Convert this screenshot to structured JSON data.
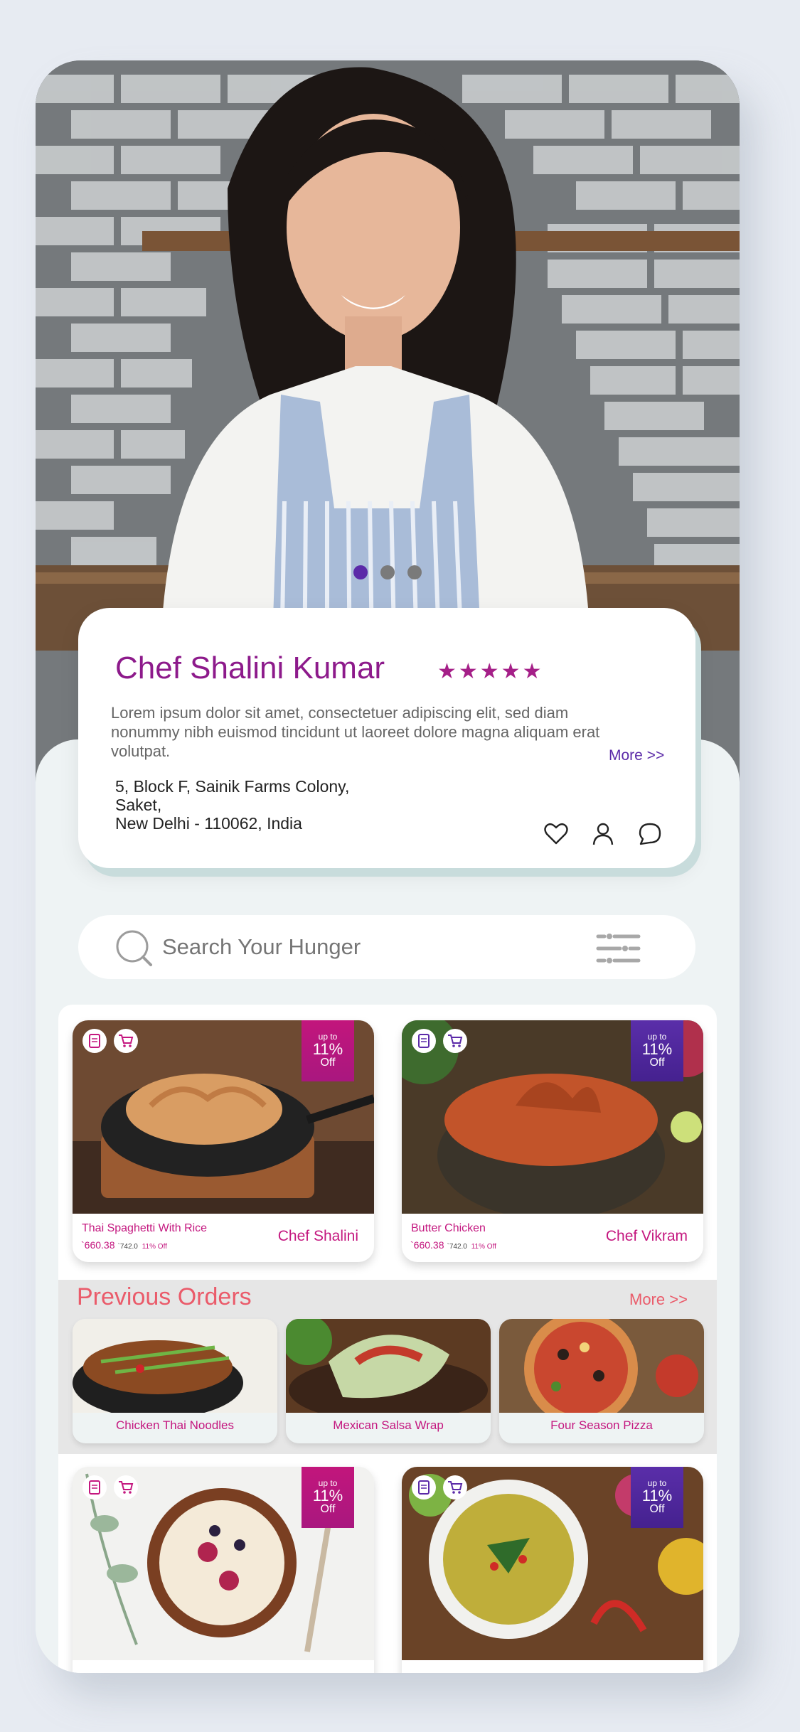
{
  "carousel": {
    "slides": 3,
    "active_index": 0
  },
  "chef": {
    "name": "Chef Shalini Kumar",
    "rating": 5,
    "stars": "★★★★★",
    "description": "Lorem ipsum dolor sit amet, consectetuer adipiscing elit, sed diam nonummy nibh euismod tincidunt ut laoreet dolore magna aliquam erat volutpat.",
    "more_label": "More >>",
    "address_line1": "5, Block F, Sainik Farms Colony, Saket,",
    "address_line2": "New Delhi - 110062, India",
    "icons": [
      "heart-icon",
      "user-icon",
      "chat-icon"
    ]
  },
  "search": {
    "placeholder": "Search Your Hunger",
    "value": ""
  },
  "badge": {
    "line1": "up to",
    "line2": "11%",
    "line3": "Off"
  },
  "products": [
    {
      "name": "Thai Spaghetti With Rice",
      "price": "`660.38",
      "old_price": "`742.0",
      "discount": "11% Off",
      "chef": "Chef Shalini",
      "badge_color": "#b0177f"
    },
    {
      "name": "Butter Chicken",
      "price": "`660.38",
      "old_price": "`742.0",
      "discount": "11% Off",
      "chef": "Chef Vikram",
      "badge_color": "#4d249a"
    },
    {
      "name": "",
      "price": "",
      "old_price": "",
      "discount": "",
      "chef": "",
      "badge_color": "#b0177f"
    },
    {
      "name": "",
      "price": "",
      "old_price": "",
      "discount": "",
      "chef": "",
      "badge_color": "#4d249a"
    }
  ],
  "previous_orders": {
    "title": "Previous Orders",
    "more_label": "More >>",
    "items": [
      {
        "label": "Chicken Thai Noodles"
      },
      {
        "label": "Mexican Salsa Wrap"
      },
      {
        "label": "Four Season Pizza"
      }
    ]
  },
  "colors": {
    "brand_purple": "#8d1a8b",
    "accent_pink": "#c4177f",
    "accent_coral": "#ea5b6a",
    "violet": "#5b2aa8"
  }
}
